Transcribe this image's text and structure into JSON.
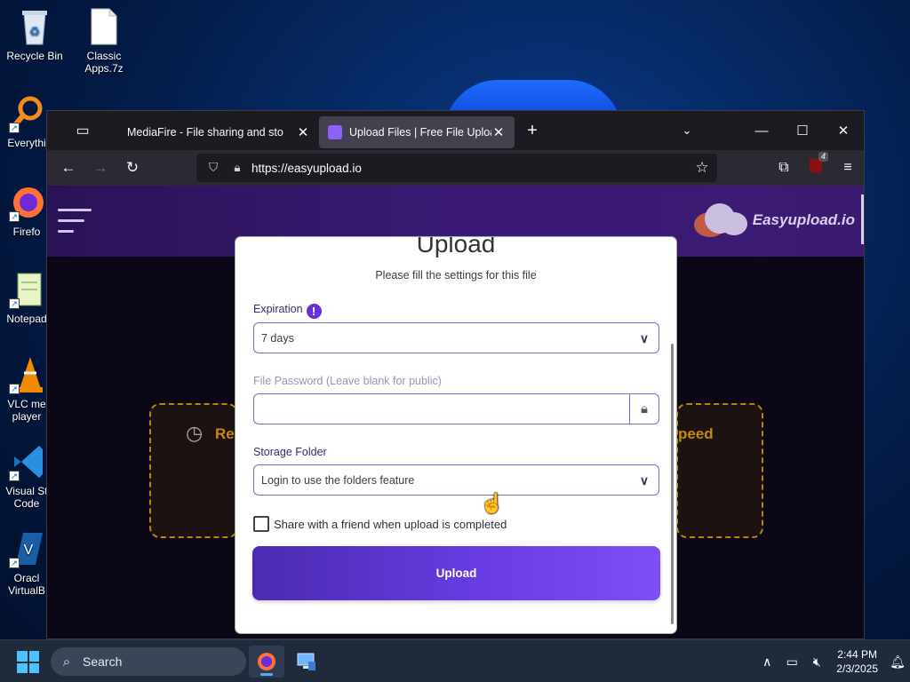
{
  "desktop": {
    "icons": [
      {
        "label": "Recycle Bin",
        "icon": "recycle-bin-icon"
      },
      {
        "label": "Classic Apps.7z",
        "icon": "archive-file-icon"
      },
      {
        "label": "Everythi",
        "icon": "everything-search-icon"
      },
      {
        "label": "Firefo",
        "icon": "firefox-icon"
      },
      {
        "label": "Notepad",
        "icon": "notepad-icon"
      },
      {
        "label": "VLC me player",
        "icon": "vlc-icon"
      },
      {
        "label": "Visual St Code",
        "icon": "vscode-icon"
      },
      {
        "label": "Oracl VirtualB",
        "icon": "virtualbox-icon"
      }
    ]
  },
  "browser": {
    "tabs": [
      {
        "title": "MediaFire - File sharing and sto",
        "active": false
      },
      {
        "title": "Upload Files | Free File Upload a",
        "active": true
      }
    ],
    "url": "https://easyupload.io",
    "extension_badge": "4"
  },
  "site": {
    "brand": "Easyupload.io",
    "background_left_text": "Re",
    "background_right_text": "peed"
  },
  "modal": {
    "title": "Upload",
    "subtitle": "Please fill the settings for this file",
    "expiration_label": "Expiration",
    "expiration_info": "!",
    "expiration_value": "7 days",
    "password_label": "File Password (Leave blank for public)",
    "password_value": "",
    "folder_label": "Storage Folder",
    "folder_value": "Login to use the folders feature",
    "share_label": "Share with a friend when upload is completed",
    "share_checked": false,
    "upload_button": "Upload"
  },
  "taskbar": {
    "search_placeholder": "Search",
    "time": "2:44 PM",
    "date": "2/3/2025"
  },
  "colors": {
    "accent": "#6a3de6",
    "header": "#2a1257",
    "field_border": "#7e6bc2"
  }
}
